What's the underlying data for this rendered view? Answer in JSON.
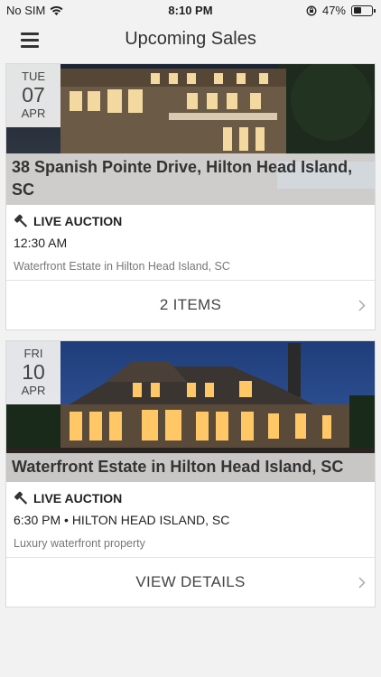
{
  "status_bar": {
    "carrier": "No SIM",
    "time": "8:10 PM",
    "battery": "47%",
    "battery_level": 0.47
  },
  "nav": {
    "title": "Upcoming Sales",
    "menu_icon": "hamburger-menu-icon"
  },
  "sales": [
    {
      "dow": "TUE",
      "day": "07",
      "month": "APR",
      "title": "38 Spanish Pointe Drive, Hilton Head Island, SC",
      "auction_type": "LIVE AUCTION",
      "time": "12:30 AM",
      "description": "Waterfront Estate in Hilton Head Island, SC",
      "action": "2 ITEMS"
    },
    {
      "dow": "FRI",
      "day": "10",
      "month": "APR",
      "title": "Waterfront Estate in Hilton Head Island, SC",
      "auction_type": "LIVE AUCTION",
      "time": "6:30 PM • HILTON HEAD ISLAND, SC",
      "description": "Luxury waterfront property",
      "action": "VIEW DETAILS"
    }
  ],
  "colors": {
    "background": "#f2f2f2",
    "card": "#ffffff",
    "text": "#222222",
    "muted": "#777777"
  }
}
